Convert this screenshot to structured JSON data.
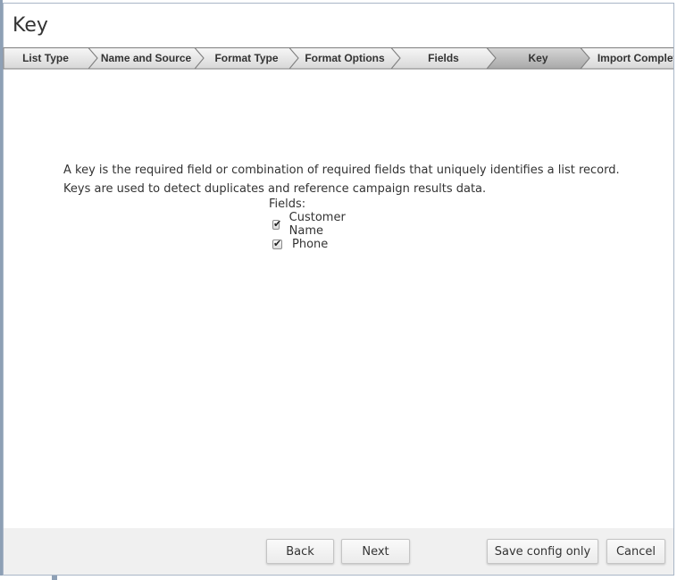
{
  "dialog": {
    "title": "Key"
  },
  "wizard": {
    "active_step": "Key",
    "steps": [
      {
        "label": "List Type"
      },
      {
        "label": "Name and Source"
      },
      {
        "label": "Format Type"
      },
      {
        "label": "Format Options"
      },
      {
        "label": "Fields"
      },
      {
        "label": "Key"
      },
      {
        "label": "Import Complete"
      }
    ]
  },
  "content": {
    "description_line1": "A key is the required field or combination of required fields that uniquely identifies a list record.",
    "description_line2": "Keys are used to detect duplicates and reference campaign results data.",
    "fields_label": "Fields:",
    "fields": [
      {
        "label": "Customer Name",
        "checked": true
      },
      {
        "label": "Phone",
        "checked": true
      }
    ]
  },
  "footer": {
    "back_label": "Back",
    "next_label": "Next",
    "save_config_label": "Save config only",
    "cancel_label": "Cancel"
  },
  "colors": {
    "step_normal_fill": "#e4e4e4",
    "step_active_fill": "#bcbcbc",
    "footer_background": "#f0f0f0",
    "dialog_border": "#a9b6c7"
  }
}
